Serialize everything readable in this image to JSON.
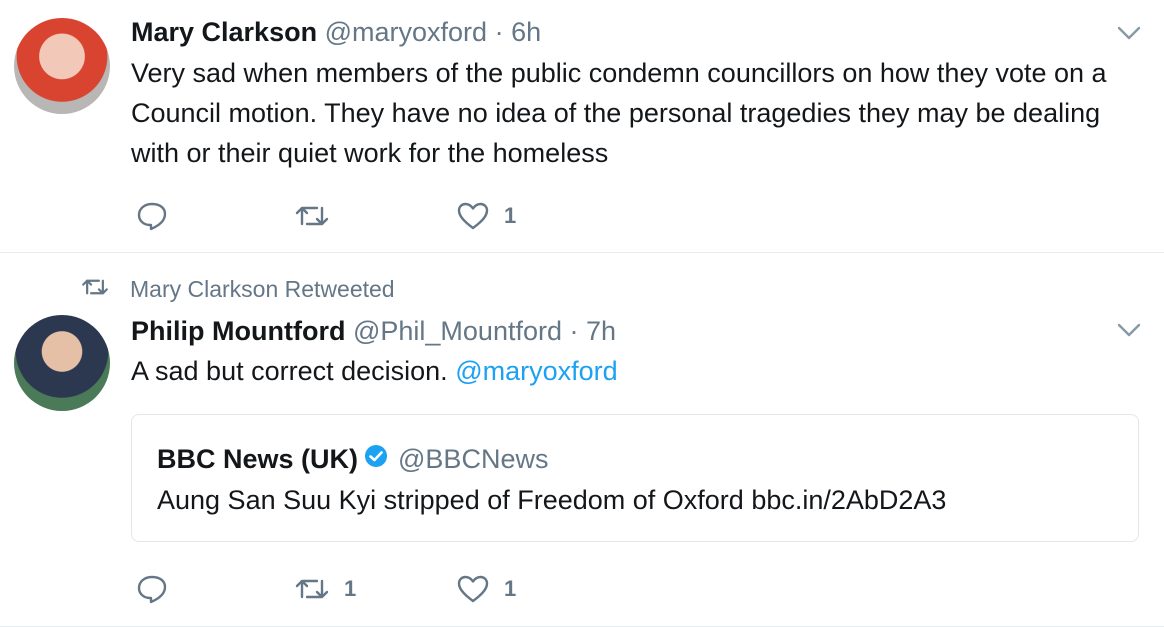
{
  "colors": {
    "accent": "#1da1f2",
    "muted": "#657786",
    "text": "#14171a",
    "border": "#e6ecf0"
  },
  "tweets": [
    {
      "author": {
        "name": "Mary Clarkson",
        "handle": "@maryoxford"
      },
      "separator": "·",
      "time": "6h",
      "text": "Very sad when members of the public condemn councillors on how they vote on a Council motion. They have no idea of the personal tragedies they may be dealing with or their quiet work for the homeless",
      "actions": {
        "replies": "",
        "retweets": "",
        "likes": "1"
      },
      "icons": {
        "reply": "reply-icon",
        "retweet": "retweet-icon",
        "like": "heart-icon",
        "menu": "chevron-down-icon"
      }
    },
    {
      "retweeted_by": "Mary Clarkson Retweeted",
      "author": {
        "name": "Philip Mountford",
        "handle": "@Phil_Mountford"
      },
      "separator": "·",
      "time": "7h",
      "text": "A sad but correct decision.",
      "mention": "@maryoxford",
      "quote": {
        "name": "BBC News (UK)",
        "handle": "@BBCNews",
        "text": "Aung San Suu Kyi stripped of Freedom of Oxford bbc.in/2AbD2A3"
      },
      "actions": {
        "replies": "",
        "retweets": "1",
        "likes": "1"
      },
      "icons": {
        "reply": "reply-icon",
        "retweet": "retweet-icon",
        "like": "heart-icon",
        "menu": "chevron-down-icon",
        "verified": "verified-badge-icon"
      }
    }
  ]
}
